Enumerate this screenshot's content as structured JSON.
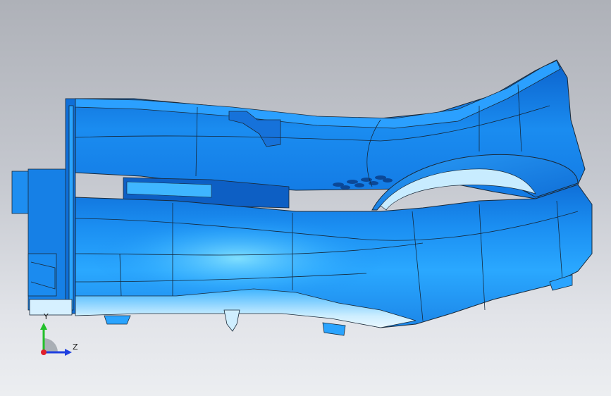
{
  "viewport": {
    "background_top": "#aeb1b8",
    "background_bottom": "#eceef1",
    "model_color": "#1e8ef0",
    "model_highlight": "#6fd4ff",
    "model_shadow": "#0a5fc8",
    "edge_color": "#1a2a3a"
  },
  "triad": {
    "y_axis_label": "Y",
    "z_axis_label": "Z",
    "y_axis_color": "#22c02a",
    "z_axis_color": "#1e3fe0",
    "x_axis_color": "#e0202a"
  }
}
